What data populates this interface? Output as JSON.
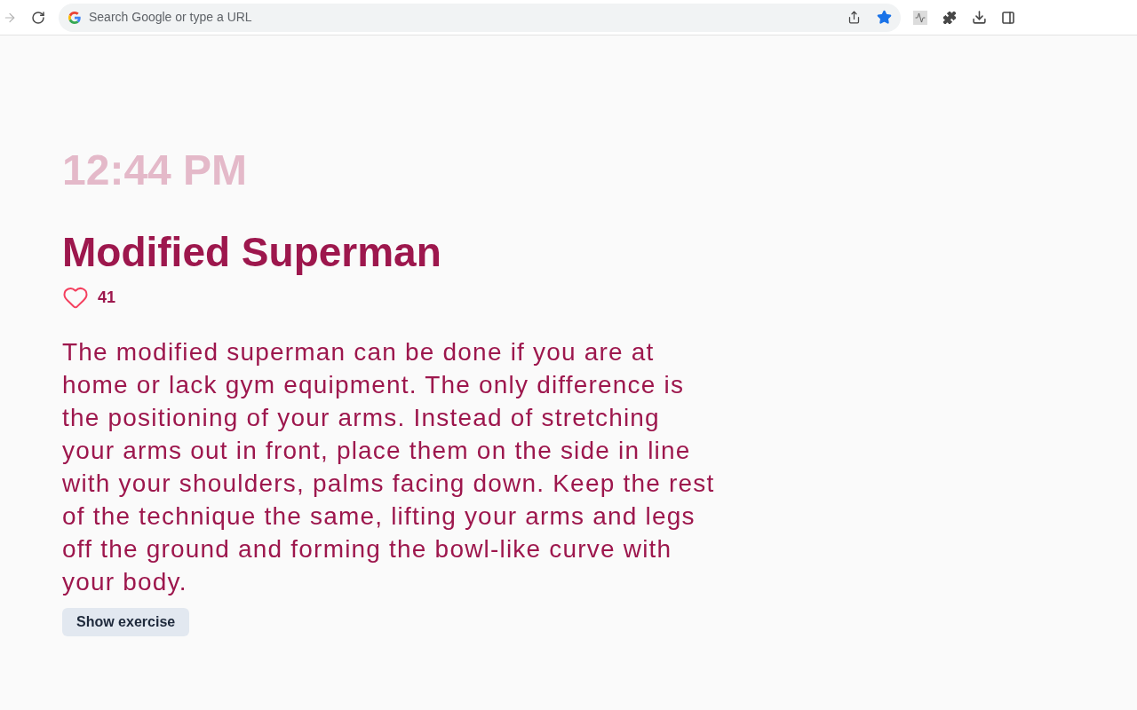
{
  "browser": {
    "forward_disabled": true,
    "omnibox": {
      "placeholder": "Search Google or type a URL"
    },
    "bookmarked": true
  },
  "exercise": {
    "time": "12:44 PM",
    "title": "Modified Superman",
    "likes": {
      "liked": false,
      "count": "41"
    },
    "description": "The modified superman can be done if you are at home or lack gym equipment. The only difference is the positioning of your arms. Instead of stretching your arms out in front, place them on the side in line with your shoulders, palms facing down. Keep the rest of the technique the same, lifting your arms and legs off the ground and forming the bowl-like curve with your body.",
    "button": "Show exercise"
  }
}
